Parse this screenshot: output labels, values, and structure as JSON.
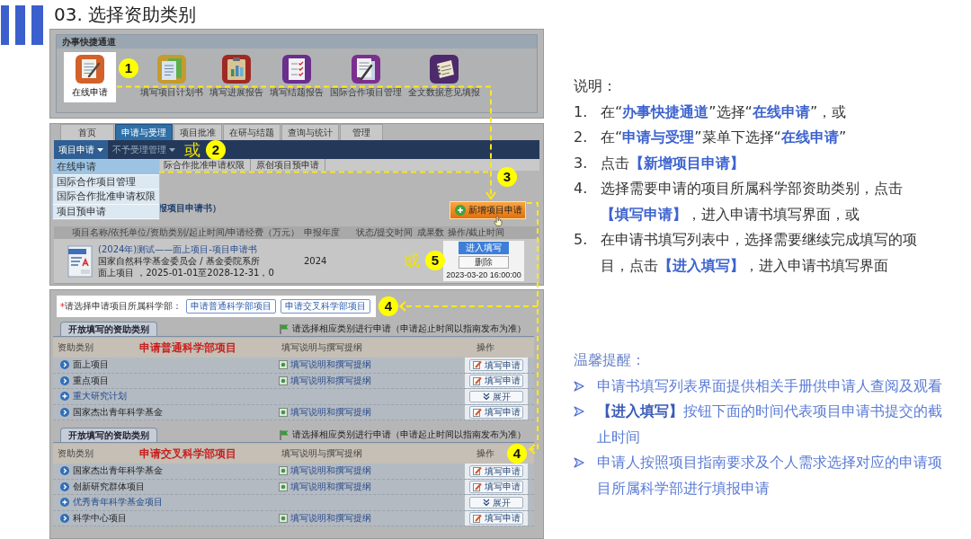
{
  "header": {
    "title": "03. 选择资助类别"
  },
  "quick_panel": {
    "title": "办事快捷通道",
    "items": [
      {
        "label": "在线申请",
        "selected": true
      },
      {
        "label": "填写项目计划书",
        "selected": false
      },
      {
        "label": "填写进展报告",
        "selected": false
      },
      {
        "label": "填写结题报告",
        "selected": false
      },
      {
        "label": "国际合作项目管理",
        "selected": false
      },
      {
        "label": "全文数据意见填报",
        "selected": false
      }
    ]
  },
  "nav_panel": {
    "tabs": [
      {
        "label": "首页",
        "selected": false
      },
      {
        "label": "申请与受理",
        "selected": true
      },
      {
        "label": "项目批准",
        "selected": false
      },
      {
        "label": "在研与结题",
        "selected": false
      },
      {
        "label": "查询与统计",
        "selected": false
      },
      {
        "label": "管理",
        "selected": false
      }
    ],
    "menus": [
      {
        "label": "项目申请",
        "selected": true
      },
      {
        "label": "不予受理管理",
        "selected": false
      }
    ],
    "dropdown": [
      {
        "label": "在线申请",
        "selected": true
      },
      {
        "label": "国际合作项目管理",
        "selected": false
      },
      {
        "label": "国际合作批准申请权限",
        "selected": false
      },
      {
        "label": "项目预申请",
        "selected": false
      }
    ],
    "submenu": [
      "际合作批准申请权限",
      "原创项目预申请"
    ],
    "list_title": "报项目申请书）",
    "new_button": "新增项目申请",
    "columns": [
      "项目名称/依托单位/资助类别/起止时间/申请经费（万元）",
      "申报年度",
      "状态/提交时间",
      "成果数",
      "操作/截止时间"
    ],
    "rows": [
      {
        "title": "(2024年)测试——面上项目-项目申请书",
        "org": "国家自然科学基金委员会 / 基金委院系所",
        "meta": "面上项目 ，2025-01-01至2028-12-31，0",
        "year": "2024",
        "actions": [
          {
            "label": "进入填写",
            "kind": "primary"
          },
          {
            "label": "删除",
            "kind": "secondary"
          }
        ],
        "deadline": "2023-03-20 16:00:00"
      }
    ]
  },
  "category_panel": {
    "marker": "*",
    "prompt": "请选择申请项目所属科学部：",
    "choices": [
      "申请普通科学部项目",
      "申请交叉科学部项目"
    ],
    "sections": [
      {
        "tab": "开放填写的资助类别",
        "notice": "请选择相应类别进行申请（申请起止时间以指南发布为准）",
        "columns": [
          "资助类别",
          "填写说明与撰写提纲",
          "操作"
        ],
        "heading": "申请普通科学部项目",
        "rows": [
          {
            "kind": "apply",
            "name": "面上项目",
            "guide": "填写说明和撰写提纲",
            "action": "填写申请"
          },
          {
            "kind": "apply",
            "name": "重点项目",
            "guide": "填写说明和撰写提纲",
            "action": "填写申请"
          },
          {
            "kind": "expand",
            "name": "重大研究计划",
            "action": "展开"
          },
          {
            "kind": "apply",
            "name": "国家杰出青年科学基金",
            "guide": "填写说明和撰写提纲",
            "action": "填写申请"
          }
        ]
      },
      {
        "tab": "开放填写的资助类别",
        "notice": "请选择相应类别进行申请（申请起止时间以指南发布为准）",
        "columns": [
          "资助类别",
          "填写说明与撰写提纲",
          "操作"
        ],
        "heading": "申请交叉科学部项目",
        "rows": [
          {
            "kind": "apply",
            "name": "国家杰出青年科学基金",
            "guide": "填写说明和撰写提纲",
            "action": "填写申请"
          },
          {
            "kind": "apply",
            "name": "创新研究群体项目",
            "guide": "填写说明和撰写提纲",
            "action": "填写申请"
          },
          {
            "kind": "expand",
            "name": "优秀青年科学基金项目",
            "action": "展开"
          },
          {
            "kind": "apply",
            "name": "科学中心项目",
            "guide": "填写说明和撰写提纲",
            "action": "填写申请"
          }
        ]
      }
    ]
  },
  "annotations": [
    {
      "label": "1"
    },
    {
      "label": "2",
      "prefix": "或"
    },
    {
      "label": "3"
    },
    {
      "label": "5",
      "prefix": "或"
    },
    {
      "label": "4"
    },
    {
      "label": "4"
    }
  ],
  "notes": {
    "title": "说明：",
    "steps": [
      {
        "num": "1.",
        "text": "在“**办事快捷通道**”选择“**在线申请**”，或"
      },
      {
        "num": "2.",
        "text": "在“**申请与受理**”菜单下选择“**在线申请**”"
      },
      {
        "num": "3.",
        "text": "点击**【新增项目申请】**"
      },
      {
        "num": "4.",
        "text": "选择需要申请的项目所属科学部资助类别，点击**【填写申请】**，进入申请书填写界面，或"
      },
      {
        "num": "5.",
        "text": "在申请书填写列表中，选择需要继续完成填写的项目，点击**【进入填写】**，进入申请书填写界面"
      }
    ]
  },
  "tips": {
    "title": "温馨提醒：",
    "items": [
      "申请书填写列表界面提供相关手册供申请人查阅及观看",
      "**【进入填写】**按钮下面的时间代表项目申请书提交的截止时间",
      "申请人按照项目指南要求及个人需求选择对应的申请项目所属科学部进行填报申请"
    ]
  }
}
